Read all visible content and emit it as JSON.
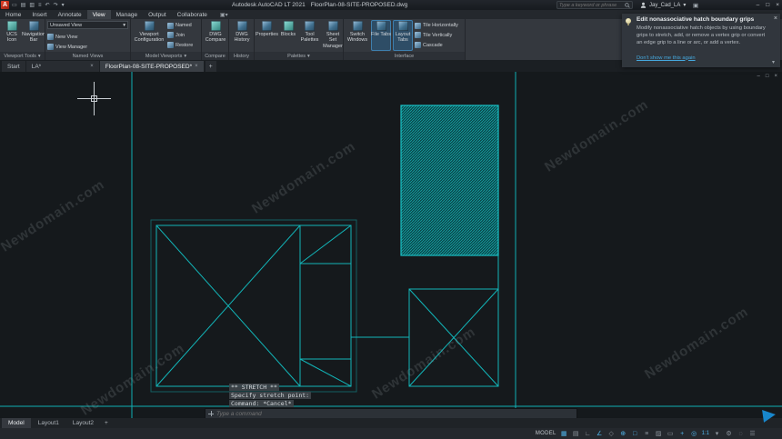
{
  "icons": {
    "close": "×",
    "chevron_down": "▾",
    "plus": "+",
    "minimize": "–",
    "restore": "□",
    "cart": "▣",
    "ribbon_toggle": "▣",
    "qat": [
      "▭",
      "▤",
      "▥",
      "≡",
      "↶",
      "↷",
      "▾"
    ]
  },
  "titlebar": {
    "logo_letter": "A",
    "app_title": "Autodesk AutoCAD LT 2021",
    "doc_title": "FloorPlan-08-SITE-PROPOSED.dwg",
    "search_placeholder": "Type a keyword or phrase",
    "user_name": "Jay_Cad_LA"
  },
  "menubar": {
    "tabs": [
      {
        "label": "Home"
      },
      {
        "label": "Insert"
      },
      {
        "label": "Annotate"
      },
      {
        "label": "View"
      },
      {
        "label": "Manage"
      },
      {
        "label": "Output"
      },
      {
        "label": "Collaborate"
      }
    ],
    "active_tab": "View"
  },
  "ribbon": {
    "panels": {
      "viewport_tools": {
        "label": "Viewport Tools",
        "buttons": [
          {
            "label": "UCS Icon"
          },
          {
            "label": "Navigation Bar"
          }
        ]
      },
      "named_views": {
        "label": "Named Views",
        "dropdown_value": "Unsaved View",
        "buttons": [
          {
            "label": "New View"
          },
          {
            "label": "View Manager"
          }
        ]
      },
      "model_viewports": {
        "label": "Model Viewports",
        "big_button": "Viewport Configuration",
        "buttons": [
          {
            "label": "Named"
          },
          {
            "label": "Join"
          },
          {
            "label": "Restore"
          }
        ]
      },
      "compare": {
        "label": "Compare",
        "big_button": "DWG Compare"
      },
      "history": {
        "label": "History",
        "big_button": "DWG History"
      },
      "palettes": {
        "label": "Palettes",
        "buttons": [
          {
            "label": "Properties"
          },
          {
            "label": "Blocks"
          },
          {
            "label": "Tool Palettes"
          },
          {
            "label": "Sheet Set Manager"
          }
        ]
      },
      "interface": {
        "label": "Interface",
        "buttons": [
          {
            "label": "Switch Windows"
          },
          {
            "label": "File Tabs"
          },
          {
            "label": "Layout Tabs"
          }
        ],
        "side_buttons": [
          {
            "label": "Tile Horizontally"
          },
          {
            "label": "Tile Vertically"
          },
          {
            "label": "Cascade"
          }
        ]
      }
    }
  },
  "file_tabs": {
    "tabs": [
      {
        "label": "Start"
      },
      {
        "label": "LA*"
      },
      {
        "label": "FloorPlan-08-SITE-PROPOSED*"
      }
    ],
    "new_tab": "+"
  },
  "notification": {
    "title": "Edit nonassociative hatch boundary grips",
    "body": "Modify nonassociative hatch objects by using boundary grips to stretch, add, or remove a vertex grip or convert an edge grip to a line or arc, or add a vertex.",
    "dismiss_link": "Don't show me this again"
  },
  "canvas": {
    "watermark": "Newdomain.com",
    "command_history": {
      "line1": "** STRETCH **",
      "line2": "Specify stretch point:",
      "line3": "Command: *Cancel*"
    }
  },
  "command_bar": {
    "placeholder": "Type a command"
  },
  "layout_tabs": {
    "tabs": [
      {
        "label": "Model"
      },
      {
        "label": "Layout1"
      },
      {
        "label": "Layout2"
      }
    ],
    "new_tab": "+"
  },
  "status_bar": {
    "model_label": "MODEL",
    "scale_label": "1:1",
    "icons": [
      {
        "name": "grid",
        "glyph": "▦",
        "on": true
      },
      {
        "name": "snap-mode",
        "glyph": "▤",
        "on": false
      },
      {
        "name": "ortho",
        "glyph": "∟",
        "on": false
      },
      {
        "name": "polar-tracking",
        "glyph": "∠",
        "on": true
      },
      {
        "name": "isodraft",
        "glyph": "◇",
        "on": false
      },
      {
        "name": "object-snap-tracking",
        "glyph": "⊕",
        "on": true
      },
      {
        "name": "object-snap",
        "glyph": "□",
        "on": true
      },
      {
        "name": "lineweight",
        "glyph": "≡",
        "on": false
      },
      {
        "name": "transparency",
        "glyph": "▨",
        "on": false
      },
      {
        "name": "selection-cycling",
        "glyph": "▭",
        "on": false
      },
      {
        "name": "dynamic-input",
        "glyph": "+",
        "on": true
      },
      {
        "name": "annotation-visibility",
        "glyph": "◎",
        "on": true
      },
      {
        "name": "workspace",
        "glyph": "⚙",
        "on": false
      },
      {
        "name": "isolate-objects",
        "glyph": "◌",
        "on": false
      },
      {
        "name": "customize",
        "glyph": "☰",
        "on": false
      }
    ]
  },
  "colors": {
    "accent": "#0696d7",
    "line_teal": "#12b5b8"
  }
}
